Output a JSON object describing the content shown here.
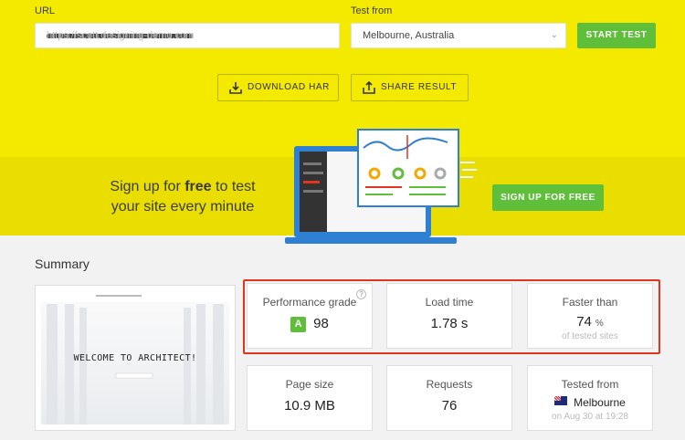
{
  "form": {
    "url_label": "URL",
    "url_value": "https://scott.designing-demo.com",
    "test_from_label": "Test from",
    "location": "Melbourne, Australia",
    "start_label": "START TEST"
  },
  "actions": {
    "download_har": "DOWNLOAD HAR",
    "share_result": "SHARE RESULT"
  },
  "promo": {
    "line1_prefix": "Sign up for ",
    "line1_bold": "free",
    "line1_suffix": " to test",
    "line2": "your site every minute",
    "button": "SIGN UP FOR FREE"
  },
  "summary": {
    "title": "Summary",
    "screenshot_title": "WELCOME TO ARCHITECT!",
    "performance": {
      "title": "Performance grade",
      "grade": "A",
      "value": "98",
      "help": "?"
    },
    "load_time": {
      "title": "Load time",
      "value": "1.78 s"
    },
    "faster_than": {
      "title": "Faster than",
      "value": "74",
      "unit": "%",
      "note": "of tested sites"
    },
    "page_size": {
      "title": "Page size",
      "value": "10.9 MB"
    },
    "requests": {
      "title": "Requests",
      "value": "76"
    },
    "tested_from": {
      "title": "Tested from",
      "city": "Melbourne",
      "date": "on Aug 30 at 19:28"
    }
  },
  "colors": {
    "brand_yellow": "#f4ea00",
    "accent_green": "#5fbf3a",
    "highlight_red": "#e0361f"
  }
}
